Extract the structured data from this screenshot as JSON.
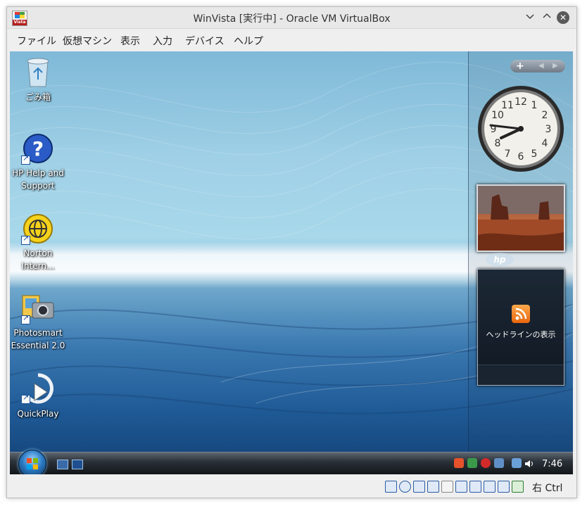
{
  "window": {
    "title": "WinVista [実行中] - Oracle VM VirtualBox",
    "app_icon_text": "Vista",
    "controls": [
      "minimize",
      "maximize",
      "close"
    ]
  },
  "menu": {
    "items": [
      "ファイル",
      "仮想マシン",
      "表示",
      "入力",
      "デバイス",
      "ヘルプ"
    ]
  },
  "desktop": {
    "icons": [
      {
        "name": "recycle-bin",
        "label": "ごみ箱"
      },
      {
        "name": "hp-help",
        "label_lines": [
          "HP Help and",
          "Support"
        ]
      },
      {
        "name": "norton",
        "label_lines": [
          "Norton",
          "Intern..."
        ]
      },
      {
        "name": "photosmart",
        "label_lines": [
          "Photosmart",
          "Essential 2.0"
        ]
      },
      {
        "name": "quickplay",
        "label": "QuickPlay"
      }
    ]
  },
  "sidebar": {
    "controls": {
      "add": "+",
      "prev": "◀",
      "next": "▶"
    },
    "clock": {
      "numbers": [
        "12",
        "1",
        "2",
        "3",
        "4",
        "5",
        "6",
        "7",
        "8",
        "9",
        "10",
        "11"
      ]
    },
    "hp_logo": "hp",
    "feed": {
      "label": "ヘッドラインの表示"
    }
  },
  "taskbar": {
    "time": "7:46"
  },
  "statusbar": {
    "host_key": "右 Ctrl"
  }
}
